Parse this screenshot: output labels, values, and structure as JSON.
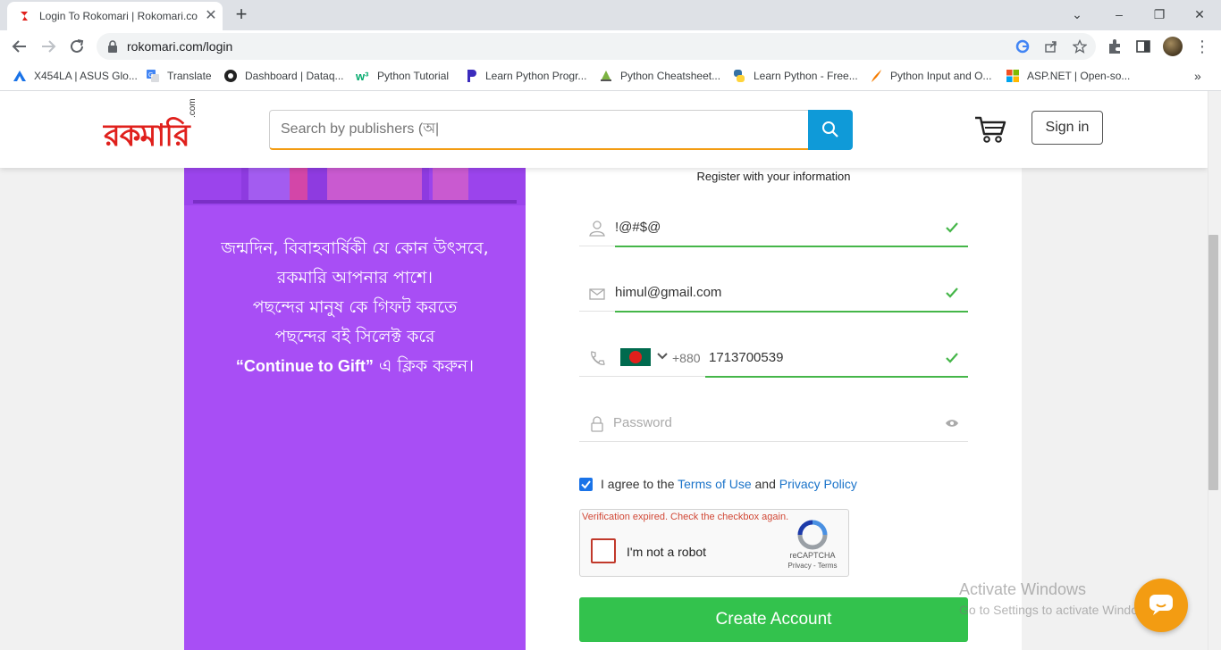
{
  "browser": {
    "tab_title": "Login To Rokomari | Rokomari.co",
    "url": "rokomari.com/login",
    "bookmarks": [
      {
        "label": "X454LA | ASUS Glo...",
        "icon": "asus-icon"
      },
      {
        "label": "Translate",
        "icon": "translate-icon"
      },
      {
        "label": "Dashboard | Dataq...",
        "icon": "dataquest-icon"
      },
      {
        "label": "Python Tutorial",
        "icon": "w3schools-icon"
      },
      {
        "label": "Learn Python Progr...",
        "icon": "programiz-icon"
      },
      {
        "label": "Python Cheatsheet...",
        "icon": "cheatsheet-icon"
      },
      {
        "label": "Learn Python - Free...",
        "icon": "python-icon"
      },
      {
        "label": "Python Input and O...",
        "icon": "javatpoint-icon"
      },
      {
        "label": "ASP.NET | Open-so...",
        "icon": "microsoft-icon"
      }
    ]
  },
  "header": {
    "logo_text": "রকমারি",
    "logo_suffix": ".com",
    "search_placeholder": "Search by publishers (অ|",
    "signin_label": "Sign in"
  },
  "promo": {
    "line1": "জন্মদিন, বিবাহবার্ষিকী যে কোন উৎসবে,",
    "line2": "রকমারি আপনার পাশে।",
    "line3": "পছন্দের মানুষ কে গিফট করতে",
    "line4": "পছন্দের বই সিলেক্ট করে",
    "line5_en": "“Continue to Gift”",
    "line5_bn": " এ ক্লিক করুন।"
  },
  "form": {
    "subtitle": "Register with your information",
    "name_value": "!@#$@",
    "email_value": "himul@gmail.com",
    "country_code": "+880",
    "phone_value": "1713700539",
    "password_placeholder": "Password",
    "agree_prefix": "I agree to the ",
    "terms_label": "Terms of Use",
    "agree_and": " and ",
    "privacy_label": "Privacy Policy",
    "recaptcha_error": "Verification expired. Check the checkbox again.",
    "recaptcha_label": "I'm not a robot",
    "recaptcha_brand": "reCAPTCHA",
    "recaptcha_links": "Privacy - Terms",
    "create_label": "Create Account"
  },
  "watermark": {
    "title": "Activate Windows",
    "subtitle": "Go to Settings to activate Windows."
  },
  "colors": {
    "brand_red": "#e0201c",
    "search_blue": "#0f9ad8",
    "promo_purple": "#a84ef5",
    "valid_green": "#45b649",
    "create_green": "#33c24d",
    "chat_orange": "#f39c12"
  }
}
